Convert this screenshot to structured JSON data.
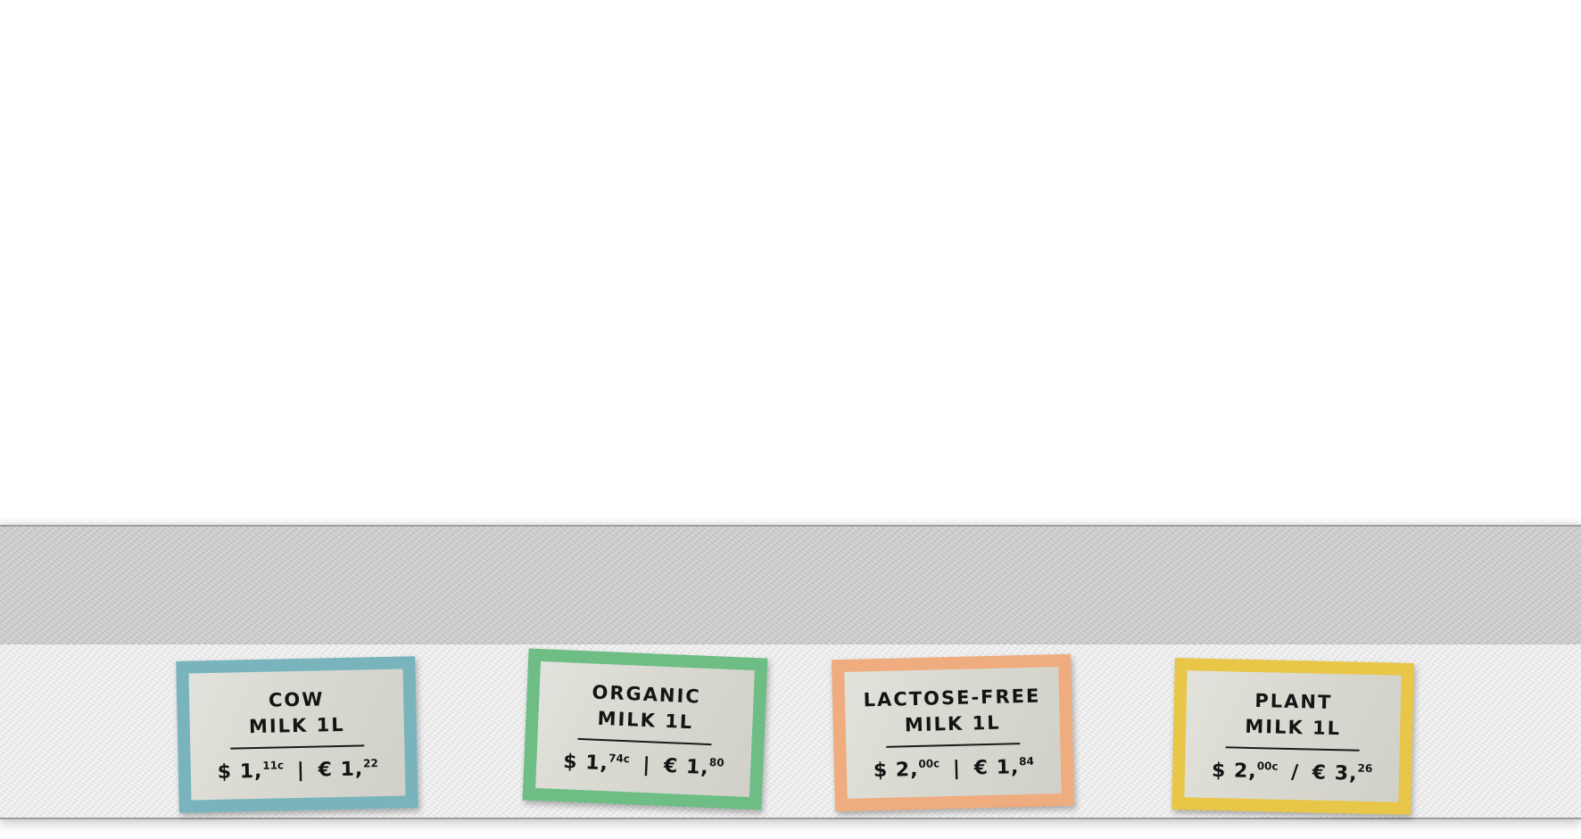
{
  "colors": {
    "cow_border": "#79b4bd",
    "organic_border": "#6dbd85",
    "lactose_border": "#eeac7f",
    "plant_border": "#e7c648",
    "card_fill": "#d9d9d1",
    "shelf_top": "#cfcfcf",
    "shelf_front": "#ececec"
  },
  "tags": [
    {
      "line1": "COW",
      "line2": "MILK 1L",
      "usd_main": "$ 1,",
      "usd_cents": "11c",
      "separator": "|",
      "eur_main": "€ 1,",
      "eur_cents": "22"
    },
    {
      "line1": "ORGANIC",
      "line2": "MILK 1L",
      "usd_main": "$ 1,",
      "usd_cents": "74c",
      "separator": "|",
      "eur_main": "€ 1,",
      "eur_cents": "80"
    },
    {
      "line1": "LACTOSE-FREE",
      "line2": "MILK 1L",
      "usd_main": "$ 2,",
      "usd_cents": "00c",
      "separator": "|",
      "eur_main": "€ 1,",
      "eur_cents": "84"
    },
    {
      "line1": "PLANT",
      "line2": "MILK 1L",
      "usd_main": "$ 2,",
      "usd_cents": "00c",
      "separator": "/",
      "eur_main": "€ 3,",
      "eur_cents": "26"
    }
  ]
}
